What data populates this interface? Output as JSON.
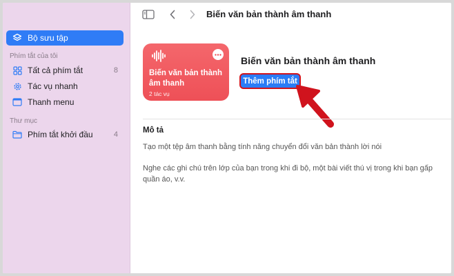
{
  "window": {
    "title": "Biến văn bản thành âm thanh"
  },
  "sidebar": {
    "collection": {
      "label": "Bộ sưu tập",
      "icon": "layers-icon"
    },
    "my_shortcuts_title": "Phím tắt của tôi",
    "items": [
      {
        "label": "Tất cả phím tắt",
        "count": "8",
        "icon": "grid-icon"
      },
      {
        "label": "Tác vụ nhanh",
        "icon": "gear-icon"
      },
      {
        "label": "Thanh menu",
        "icon": "menubar-icon"
      }
    ],
    "folders_title": "Thư mục",
    "folders": [
      {
        "label": "Phím tắt khởi đầu",
        "count": "4",
        "icon": "folder-icon"
      }
    ]
  },
  "card": {
    "name": "Biến văn bản thành âm thanh",
    "subtitle": "2 tác vụ",
    "icon": "waveform-icon",
    "color": "#ee5057"
  },
  "detail": {
    "title": "Biến văn bản thành âm thanh",
    "add_button": "Thêm phím tắt",
    "description_heading": "Mô tả",
    "description_lines": [
      "Tạo một tệp âm thanh bằng tính năng chuyển đổi văn bản thành lời nói",
      "Nghe các ghi chú trên lớp của bạn trong khi đi bộ, một bài viết thú vị trong khi bạn gấp",
      "quần áo, v.v."
    ]
  },
  "colors": {
    "accent": "#2f7cf6",
    "sidebar": "#ecd6ec",
    "annotation": "#d0131d"
  }
}
